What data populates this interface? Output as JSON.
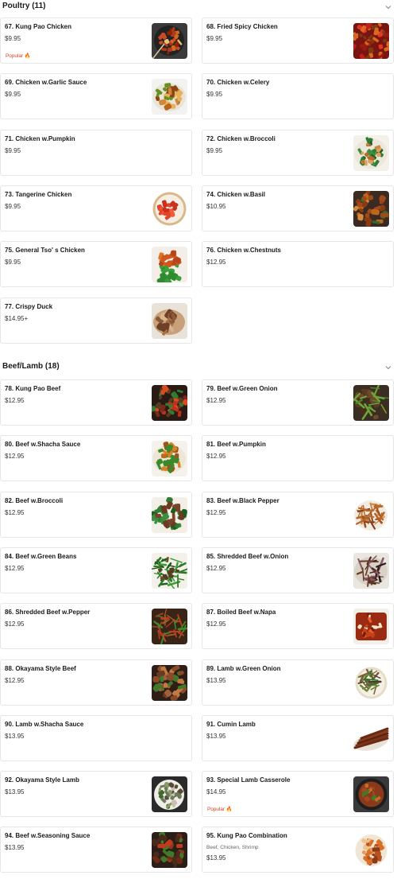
{
  "sections": [
    {
      "title": "Poultry (11)",
      "items": [
        {
          "name": "67. Kung Pao Chicken",
          "price": "$9.95",
          "badge": "Popular 🔥",
          "img": "kungpao"
        },
        {
          "name": "68. Fried Spicy Chicken",
          "price": "$9.95",
          "img": "redpepper"
        },
        {
          "name": "69. Chicken w.Garlic Sauce",
          "price": "$9.95",
          "img": "garlic"
        },
        {
          "name": "70. Chicken w.Celery",
          "price": "$9.95"
        },
        {
          "name": "71. Chicken w.Pumpkin",
          "price": "$9.95"
        },
        {
          "name": "72. Chicken w.Broccoli",
          "price": "$9.95",
          "img": "broccoli"
        },
        {
          "name": "73. Tangerine Chicken",
          "price": "$9.95",
          "img": "tangerine"
        },
        {
          "name": "74. Chicken w.Basil",
          "price": "$10.95",
          "img": "basil"
        },
        {
          "name": "75. General Tso' s Chicken",
          "price": "$9.95",
          "img": "generaltso"
        },
        {
          "name": "76. Chicken w.Chestnuts",
          "price": "$12.95"
        },
        {
          "name": "77. Crispy Duck",
          "price": "$14.95+",
          "img": "duck"
        }
      ]
    },
    {
      "title": "Beef/Lamb (18)",
      "items": [
        {
          "name": "78. Kung Pao Beef",
          "price": "$12.95",
          "img": "kungpaobeef"
        },
        {
          "name": "79. Beef w.Green Onion",
          "price": "$12.95",
          "img": "greenonionbeef"
        },
        {
          "name": "80. Beef w.Shacha Sauce",
          "price": "$12.95",
          "img": "shacha"
        },
        {
          "name": "81. Beef w.Pumpkin",
          "price": "$12.95"
        },
        {
          "name": "82. Beef w.Broccoli",
          "price": "$12.95",
          "img": "beefbroccoli"
        },
        {
          "name": "83. Beef w.Black Pepper",
          "price": "$12.95",
          "img": "blackpepper"
        },
        {
          "name": "84. Beef w.Green Beans",
          "price": "$12.95",
          "img": "greenbeans"
        },
        {
          "name": "85. Shredded Beef w.Onion",
          "price": "$12.95",
          "img": "shreddedonion"
        },
        {
          "name": "86. Shredded Beef w.Pepper",
          "price": "$12.95",
          "img": "shreddedpepper"
        },
        {
          "name": "87. Boiled Beef w.Napa",
          "price": "$12.95",
          "img": "boiled"
        },
        {
          "name": "88. Okayama Style Beef",
          "price": "$12.95",
          "img": "okayamabeef"
        },
        {
          "name": "89. Lamb w.Green Onion",
          "price": "$13.95",
          "img": "lambonion"
        },
        {
          "name": "90. Lamb w.Shacha Sauce",
          "price": "$13.95"
        },
        {
          "name": "91. Cumin Lamb",
          "price": "$13.95",
          "img": "cumin"
        },
        {
          "name": "92. Okayama Style Lamb",
          "price": "$13.95",
          "img": "okayamalamb"
        },
        {
          "name": "93. Special Lamb Casserole",
          "price": "$14.95",
          "badge": "Popular 🔥",
          "img": "casserole"
        },
        {
          "name": "94. Beef w.Seasoning Sauce",
          "price": "$13.95",
          "img": "seasoning"
        },
        {
          "name": "95. Kung Pao Combination",
          "price": "$13.95",
          "desc": "Beef, Chicken, Shrimp",
          "img": "combo"
        }
      ]
    }
  ],
  "colors": {
    "badge": "#d9401e",
    "border": "#e6e6e6",
    "chevron": "#888888"
  },
  "icons": {
    "collapse": "chevron-down-icon"
  }
}
